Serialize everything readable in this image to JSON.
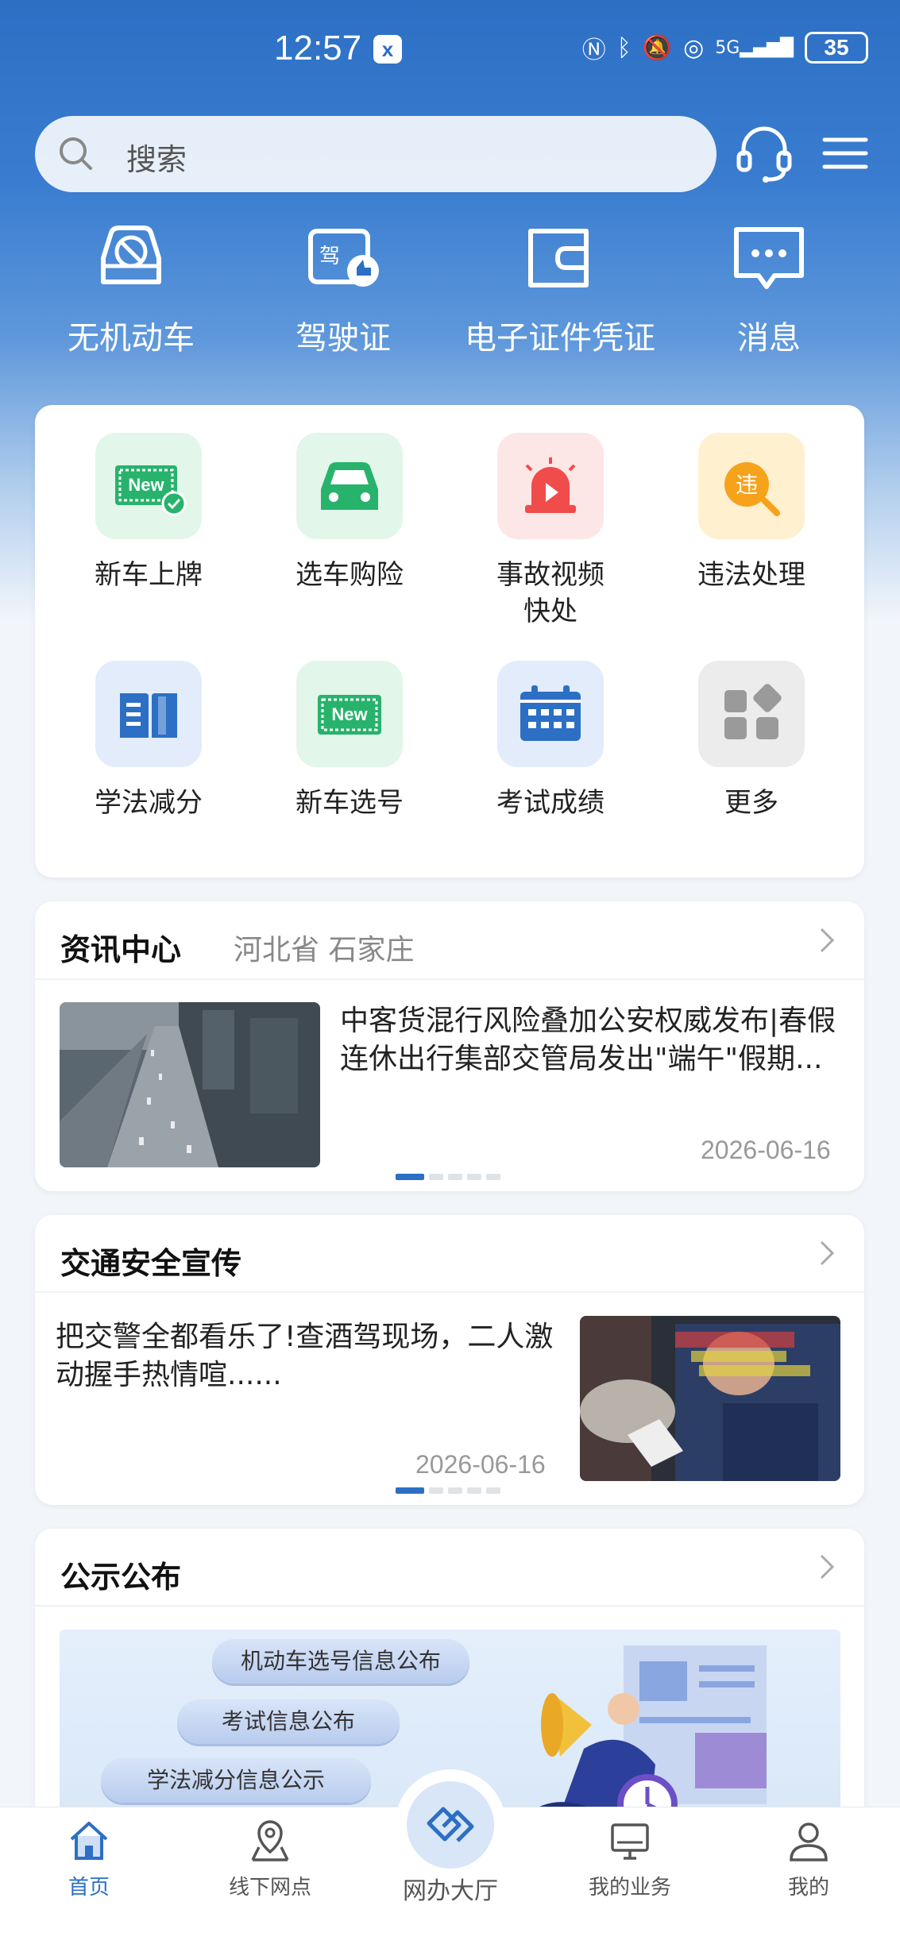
{
  "status_bar": {
    "time": "12:57",
    "battery": "35"
  },
  "header": {
    "search_placeholder": "搜索"
  },
  "quick_actions": [
    {
      "label": "无机动车",
      "icon": "no-vehicle-icon"
    },
    {
      "label": "驾驶证",
      "icon": "driver-license-icon"
    },
    {
      "label": "电子证件凭证",
      "icon": "wallet-icon"
    },
    {
      "label": "消息",
      "icon": "message-icon"
    }
  ],
  "services": [
    {
      "label": "新车上牌",
      "icon": "new-plate-icon"
    },
    {
      "label": "选车购险",
      "icon": "car-insurance-icon"
    },
    {
      "label": "事故视频快处",
      "icon": "accident-video-icon"
    },
    {
      "label": "违法处理",
      "icon": "violation-icon"
    },
    {
      "label": "学法减分",
      "icon": "book-icon"
    },
    {
      "label": "新车选号",
      "icon": "plate-number-icon"
    },
    {
      "label": "考试成绩",
      "icon": "calendar-icon"
    },
    {
      "label": "更多",
      "icon": "more-apps-icon"
    }
  ],
  "news": {
    "title": "资讯中心",
    "location": "河北省 石家庄",
    "headline": "中客货混行风险叠加公安权威发布|春假连休出行集部交管局发出\"端午\"假期...",
    "date": "2026-06-16"
  },
  "safety": {
    "title": "交通安全宣传",
    "headline": "把交警全都看乐了!查酒驾现场，二人激动握手热情喧......",
    "date": "2026-06-16"
  },
  "notice": {
    "title": "公示公布",
    "pills": [
      "机动车选号信息公布",
      "考试信息公布",
      "学法减分信息公示"
    ]
  },
  "tabbar": {
    "items": [
      "首页",
      "线下网点",
      "网办大厅",
      "我的业务",
      "我的"
    ]
  },
  "colors": {
    "brand": "#2c6fc4",
    "hero_top": "#2c6fc4"
  }
}
